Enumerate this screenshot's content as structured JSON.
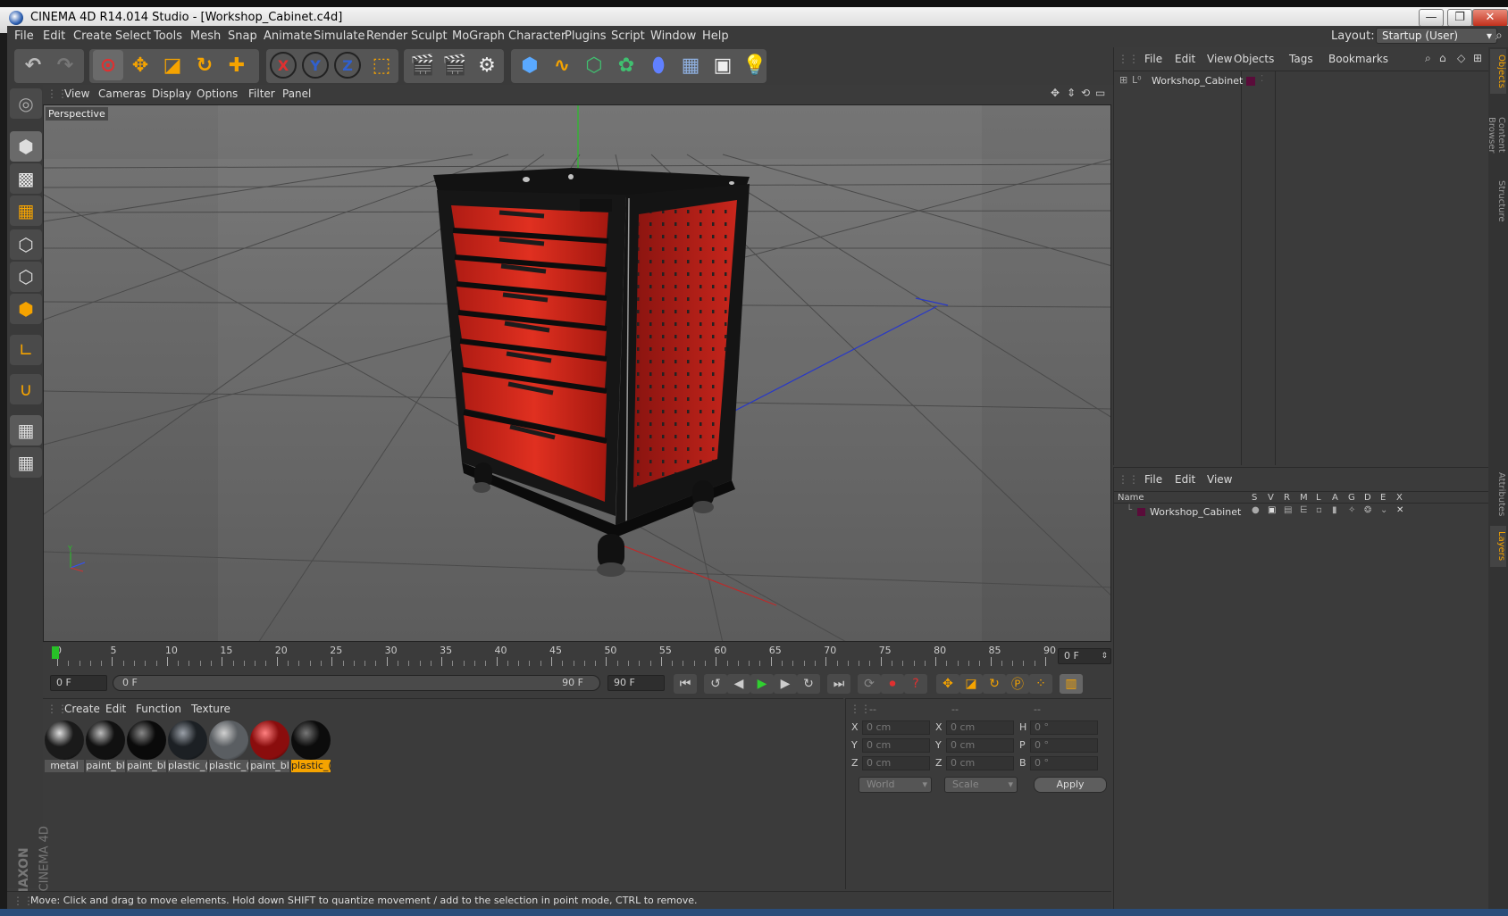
{
  "window": {
    "title": "CINEMA 4D R14.014 Studio - [Workshop_Cabinet.c4d]",
    "min_glyph": "—",
    "restore_glyph": "❐",
    "close_glyph": "✕"
  },
  "menubar": {
    "items": [
      "File",
      "Edit",
      "Create",
      "Select",
      "Tools",
      "Mesh",
      "Snap",
      "Animate",
      "Simulate",
      "Render",
      "Sculpt",
      "MoGraph",
      "Character",
      "Plugins",
      "Script",
      "Window",
      "Help"
    ],
    "layout_label": "Layout:",
    "layout_value": "Startup (User)"
  },
  "toolbar": {
    "axis_x": "X",
    "axis_y": "Y",
    "axis_z": "Z"
  },
  "viewport": {
    "menu": [
      "View",
      "Cameras",
      "Display",
      "Options",
      "Filter",
      "Panel"
    ],
    "label": "Perspective"
  },
  "timeline": {
    "ticks": [
      "0",
      "5",
      "10",
      "15",
      "20",
      "25",
      "30",
      "35",
      "40",
      "45",
      "50",
      "55",
      "60",
      "65",
      "70",
      "75",
      "80",
      "85",
      "90"
    ],
    "current_frame": "0 F",
    "start_field": "0 F",
    "range_start": "0 F",
    "range_end": "90 F",
    "end_field": "90 F"
  },
  "materials": {
    "menu": [
      "Create",
      "Edit",
      "Function",
      "Texture"
    ],
    "items": [
      {
        "label": "metal",
        "color": "#1a1a1a",
        "highlight": "#dddddd"
      },
      {
        "label": "paint_bl",
        "color": "#111111",
        "highlight": "#bbbbbb"
      },
      {
        "label": "paint_bl",
        "color": "#0a0a0a",
        "highlight": "#888888"
      },
      {
        "label": "plastic_(",
        "color": "#1c2024",
        "highlight": "#9aa0a8"
      },
      {
        "label": "plastic_(",
        "color": "#5a5e62",
        "highlight": "#d0d0d0"
      },
      {
        "label": "paint_bl",
        "color": "#8a0d0d",
        "highlight": "#ff8080"
      },
      {
        "label": "plastic_(",
        "color": "#0c0c0c",
        "highlight": "#777777"
      }
    ]
  },
  "coords": {
    "headers": [
      "--",
      "--",
      "--"
    ],
    "rows": [
      {
        "l1": "X",
        "v1": "0 cm",
        "l2": "X",
        "v2": "0 cm",
        "l3": "H",
        "v3": "0 °"
      },
      {
        "l1": "Y",
        "v1": "0 cm",
        "l2": "Y",
        "v2": "0 cm",
        "l3": "P",
        "v3": "0 °"
      },
      {
        "l1": "Z",
        "v1": "0 cm",
        "l2": "Z",
        "v2": "0 cm",
        "l3": "B",
        "v3": "0 °"
      }
    ],
    "space": "World",
    "mode": "Scale",
    "apply": "Apply"
  },
  "objects": {
    "menu": [
      "File",
      "Edit",
      "View",
      "Objects",
      "Tags",
      "Bookmarks"
    ],
    "root": "Workshop_Cabinet"
  },
  "layers": {
    "menu": [
      "File",
      "Edit",
      "View"
    ],
    "columns": [
      "Name",
      "S",
      "V",
      "R",
      "M",
      "L",
      "A",
      "G",
      "D",
      "E",
      "X"
    ],
    "row": "Workshop_Cabinet"
  },
  "right_tabs": [
    "Objects",
    "Content Browser",
    "Structure",
    "Attributes",
    "Layers"
  ],
  "brand": {
    "maker": "MAXON",
    "product": "CINEMA 4D"
  },
  "status": "Move: Click and drag to move elements. Hold down SHIFT to quantize movement / add to the selection in point mode, CTRL to remove.",
  "colors": {
    "accent": "#f5a300",
    "cabinet_red": "#c8261c",
    "cabinet_black": "#111111"
  }
}
